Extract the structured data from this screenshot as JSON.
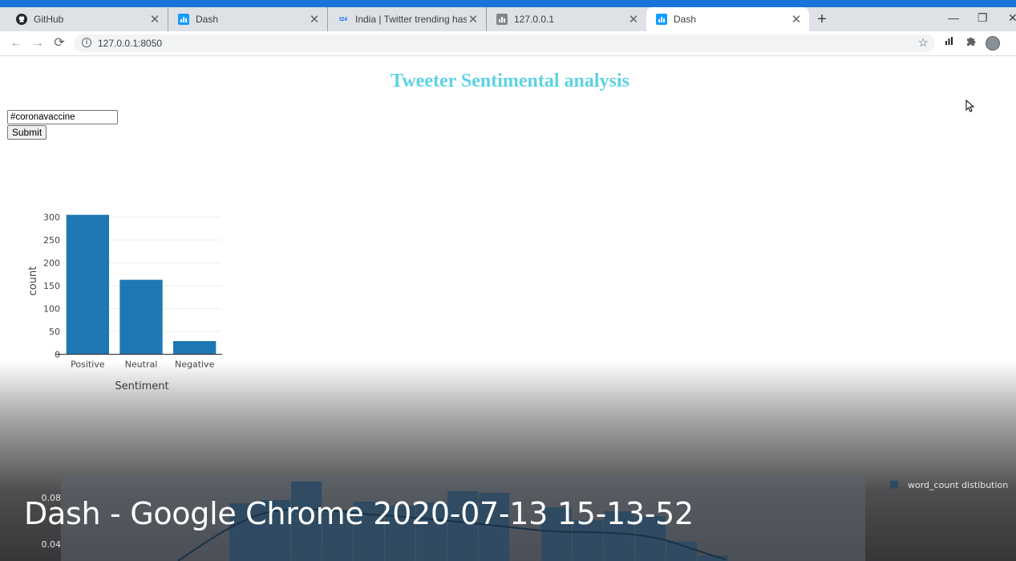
{
  "browser": {
    "tabs": [
      {
        "title": "GitHub",
        "favicon": "github-icon"
      },
      {
        "title": "Dash",
        "favicon": "dash-icon"
      },
      {
        "title": "India | Twitter trending hashtag a",
        "favicon": "t24-icon",
        "favicon_text": "t24"
      },
      {
        "title": "127.0.0.1",
        "favicon": "bar-chart-icon"
      },
      {
        "title": "Dash",
        "favicon": "dash-icon",
        "active": true
      }
    ],
    "url": "127.0.0.1:8050"
  },
  "page": {
    "title": "Tweeter Sentimental analysis",
    "title_color": "#5ed3e3",
    "hashtag_value": "#coronavaccine",
    "submit_label": "Submit"
  },
  "chart_data": [
    {
      "type": "bar",
      "categories": [
        "Positive",
        "Neutral",
        "Negative"
      ],
      "values": [
        305,
        163,
        29
      ],
      "xlabel": "Sentiment",
      "ylabel": "count",
      "ylim": [
        0,
        300
      ],
      "yticks": [
        0,
        50,
        100,
        150,
        200,
        250,
        300
      ],
      "bar_color": "#1f77b4"
    },
    {
      "type": "bar",
      "legend": "word_count distibution",
      "yticks": [
        0.04,
        0.08
      ],
      "partially_hidden": true
    }
  ],
  "video_caption": "Dash - Google Chrome 2020-07-13 15-13-52"
}
